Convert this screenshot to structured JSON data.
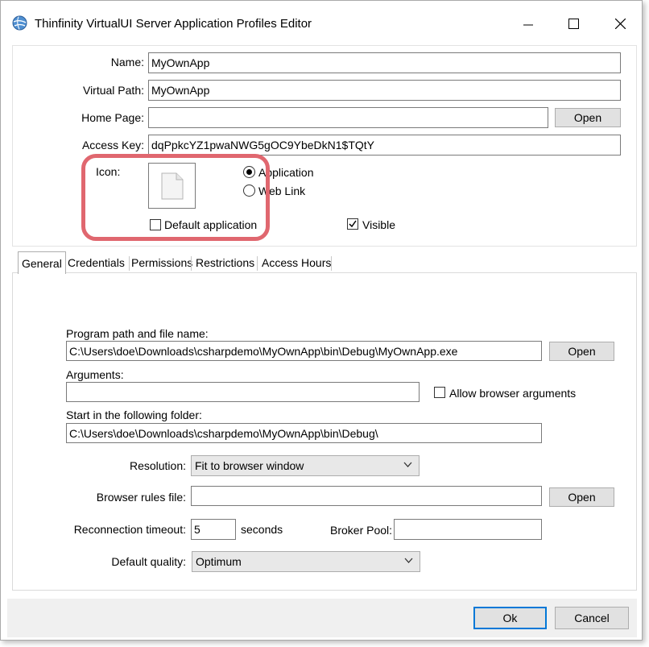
{
  "window": {
    "title": "Thinfinity VirtualUI Server Application Profiles Editor"
  },
  "header": {
    "name_label": "Name:",
    "name_value": "MyOwnApp",
    "virtual_path_label": "Virtual Path:",
    "virtual_path_value": "MyOwnApp",
    "home_page_label": "Home Page:",
    "home_page_value": "",
    "home_page_open": "Open",
    "access_key_label": "Access Key:",
    "access_key_value": "dqPpkcYZ1pwaNWG5gOC9YbeDkN1$TQtY",
    "icon_label": "Icon:",
    "radio_application": "Application",
    "radio_web_link": "Web Link",
    "default_application_label": "Default application",
    "visible_label": "Visible"
  },
  "tabs": [
    {
      "label": "General"
    },
    {
      "label": "Credentials"
    },
    {
      "label": "Permissions"
    },
    {
      "label": "Restrictions"
    },
    {
      "label": "Access Hours"
    }
  ],
  "general": {
    "program_path_label": "Program path and file name:",
    "program_path_value": "C:\\Users\\doe\\Downloads\\csharpdemo\\MyOwnApp\\bin\\Debug\\MyOwnApp.exe",
    "program_open": "Open",
    "arguments_label": "Arguments:",
    "arguments_value": "",
    "allow_browser_args_label": "Allow browser arguments",
    "start_folder_label": "Start in the following folder:",
    "start_folder_value": "C:\\Users\\doe\\Downloads\\csharpdemo\\MyOwnApp\\bin\\Debug\\",
    "resolution_label": "Resolution:",
    "resolution_value": "Fit to browser window",
    "browser_rules_label": "Browser rules file:",
    "browser_rules_value": "",
    "browser_rules_open": "Open",
    "reconnection_label": "Reconnection timeout:",
    "reconnection_value": "5",
    "seconds_label": "seconds",
    "broker_pool_label": "Broker Pool:",
    "broker_pool_value": "",
    "quality_label": "Default quality:",
    "quality_value": "Optimum"
  },
  "footer": {
    "ok": "Ok",
    "cancel": "Cancel"
  },
  "colors": {
    "highlight": "#e0676f",
    "button_face": "#e1e1e1",
    "focus_border": "#0078d7"
  }
}
